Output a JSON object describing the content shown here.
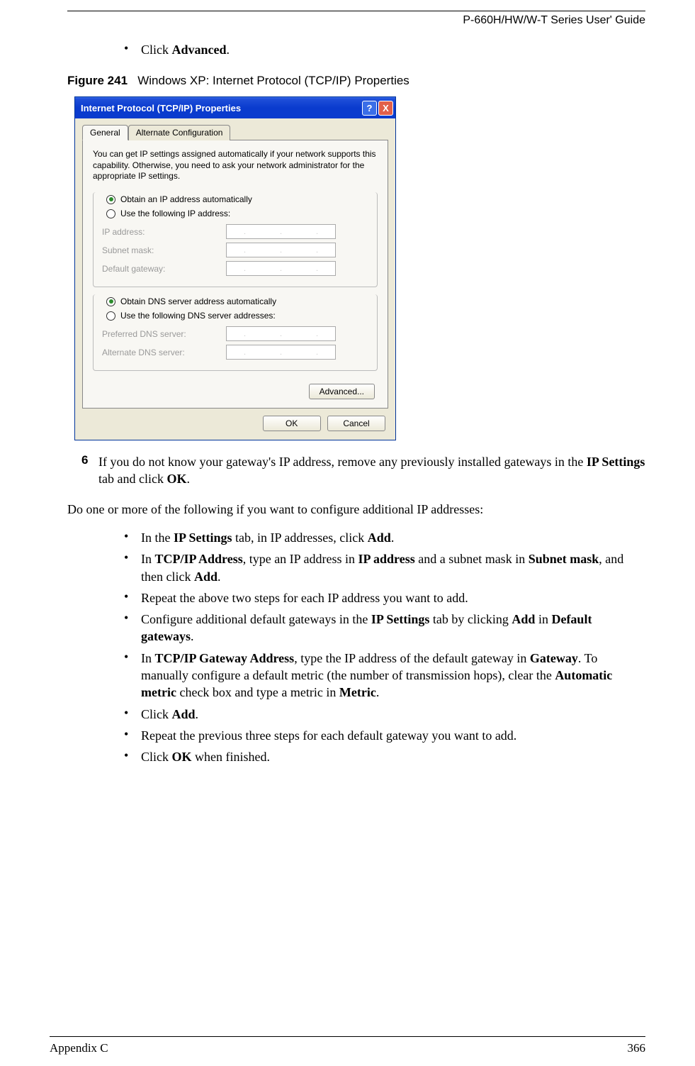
{
  "header": {
    "guide_title": "P-660H/HW/W-T Series User' Guide"
  },
  "top_bullet": {
    "prefix": "Click ",
    "bold": "Advanced",
    "suffix": "."
  },
  "figure": {
    "label": "Figure 241",
    "caption": "Windows XP: Internet Protocol (TCP/IP) Properties"
  },
  "dialog": {
    "title": "Internet Protocol (TCP/IP) Properties",
    "tabs": {
      "general": "General",
      "alternate": "Alternate Configuration"
    },
    "intro": "You can get IP settings assigned automatically if your network supports this capability. Otherwise, you need to ask your network administrator for the appropriate IP settings.",
    "radio_ip_auto": "Obtain an IP address automatically",
    "radio_ip_manual": "Use the following IP address:",
    "labels": {
      "ip": "IP address:",
      "subnet": "Subnet mask:",
      "gateway": "Default gateway:",
      "pref_dns": "Preferred DNS server:",
      "alt_dns": "Alternate DNS server:"
    },
    "radio_dns_auto": "Obtain DNS server address automatically",
    "radio_dns_manual": "Use the following DNS server addresses:",
    "buttons": {
      "advanced": "Advanced...",
      "ok": "OK",
      "cancel": "Cancel"
    }
  },
  "step6": {
    "num": "6",
    "t1": "If you do not know your gateway's IP address, remove any previously installed gateways in the ",
    "b1": "IP Settings",
    "t2": " tab and click ",
    "b2": "OK",
    "t3": "."
  },
  "para_intro": "Do one or more of the following if you want to configure additional IP addresses:",
  "list": {
    "i0": {
      "t1": "In the ",
      "b1": "IP Settings",
      "t2": " tab, in IP addresses, click ",
      "b2": "Add",
      "t3": "."
    },
    "i1": {
      "t1": "In ",
      "b1": "TCP/IP Address",
      "t2": ", type an IP address in ",
      "b2": "IP address",
      "t3": " and a subnet mask in ",
      "b3": "Subnet mask",
      "t4": ", and then click ",
      "b4": "Add",
      "t5": "."
    },
    "i2": {
      "t1": "Repeat the above two steps for each IP address you want to add."
    },
    "i3": {
      "t1": "Configure additional default gateways in the ",
      "b1": "IP Settings",
      "t2": " tab by clicking ",
      "b2": "Add",
      "t3": " in ",
      "b3": "Default gateways",
      "t4": "."
    },
    "i4": {
      "t1": "In ",
      "b1": "TCP/IP Gateway Address",
      "t2": ", type the IP address of the default gateway in ",
      "b2": "Gateway",
      "t3": ". To manually configure a default metric (the number of transmission hops), clear the ",
      "b3": "Automatic metric",
      "t4": " check box and type a metric in ",
      "b4": "Metric",
      "t5": "."
    },
    "i5": {
      "t1": "Click ",
      "b1": "Add",
      "t2": "."
    },
    "i6": {
      "t1": "Repeat the previous three steps for each default gateway you want to add."
    },
    "i7": {
      "t1": "Click ",
      "b1": "OK",
      "t2": " when finished."
    }
  },
  "footer": {
    "left": "Appendix C",
    "right": "366"
  }
}
